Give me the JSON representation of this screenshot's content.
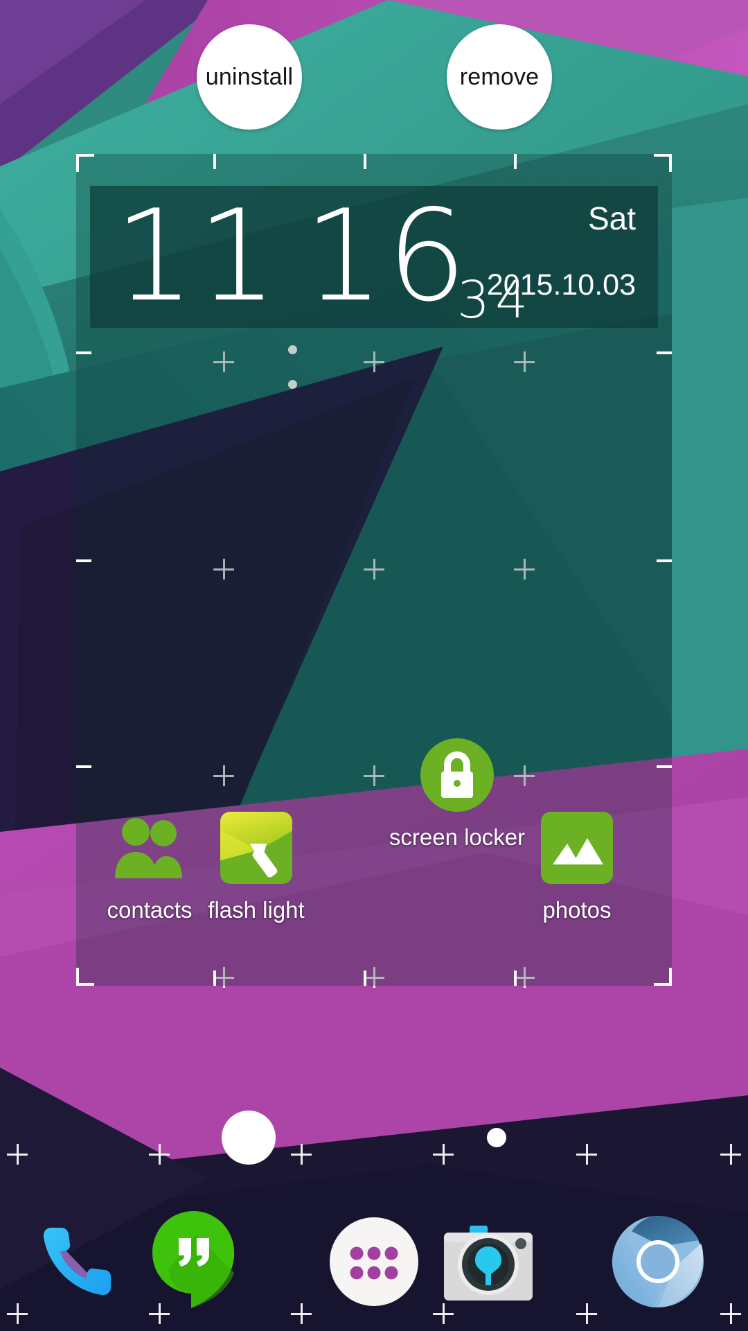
{
  "screen": {
    "device": "android-home-screen",
    "mode": "widget-drag-edit",
    "wallpaper_colors": {
      "teal_light": "#3aa294",
      "teal_mid": "#2c8177",
      "teal_deep": "#1d6f68",
      "navy": "#231a3d",
      "navy_dark": "#16122b",
      "magenta": "#b74bb2",
      "magenta_deep": "#a83fa0",
      "purple": "#6e3f8f"
    }
  },
  "actions": {
    "uninstall_label": "uninstall",
    "remove_label": "remove"
  },
  "clock_widget": {
    "hours": "11",
    "minutes": "16",
    "seconds": "34",
    "time_display": "11:16",
    "weekday": "Sat",
    "date": "2015.10.03",
    "selected": true
  },
  "workspace_icons": [
    {
      "name": "contacts",
      "label": "contacts",
      "icon": "people-icon",
      "color": "#6cb023",
      "shape": "glyph"
    },
    {
      "name": "flash-light",
      "label": "flash light",
      "icon": "flashlight-icon",
      "color": "#6cb023",
      "shape": "square"
    },
    {
      "name": "screen-locker",
      "label": "screen locker",
      "icon": "lock-icon",
      "color": "#6cb023",
      "shape": "circle"
    },
    {
      "name": "photos",
      "label": "photos",
      "icon": "image-icon",
      "color": "#6cb023",
      "shape": "square"
    }
  ],
  "page_indicator": {
    "pages": 2,
    "current": 1
  },
  "dock_icons": [
    {
      "name": "phone",
      "icon": "phone-icon",
      "color": "#28b6f6"
    },
    {
      "name": "hangouts",
      "icon": "hangouts-icon",
      "color": "#3ec20b"
    },
    {
      "name": "app-drawer",
      "icon": "apps-grid-icon",
      "color": "#f7f5f5"
    },
    {
      "name": "camera",
      "icon": "camera-icon",
      "color": "#d8d8d8"
    },
    {
      "name": "browser",
      "icon": "chromium-icon",
      "color": "#6a9fd4"
    }
  ]
}
